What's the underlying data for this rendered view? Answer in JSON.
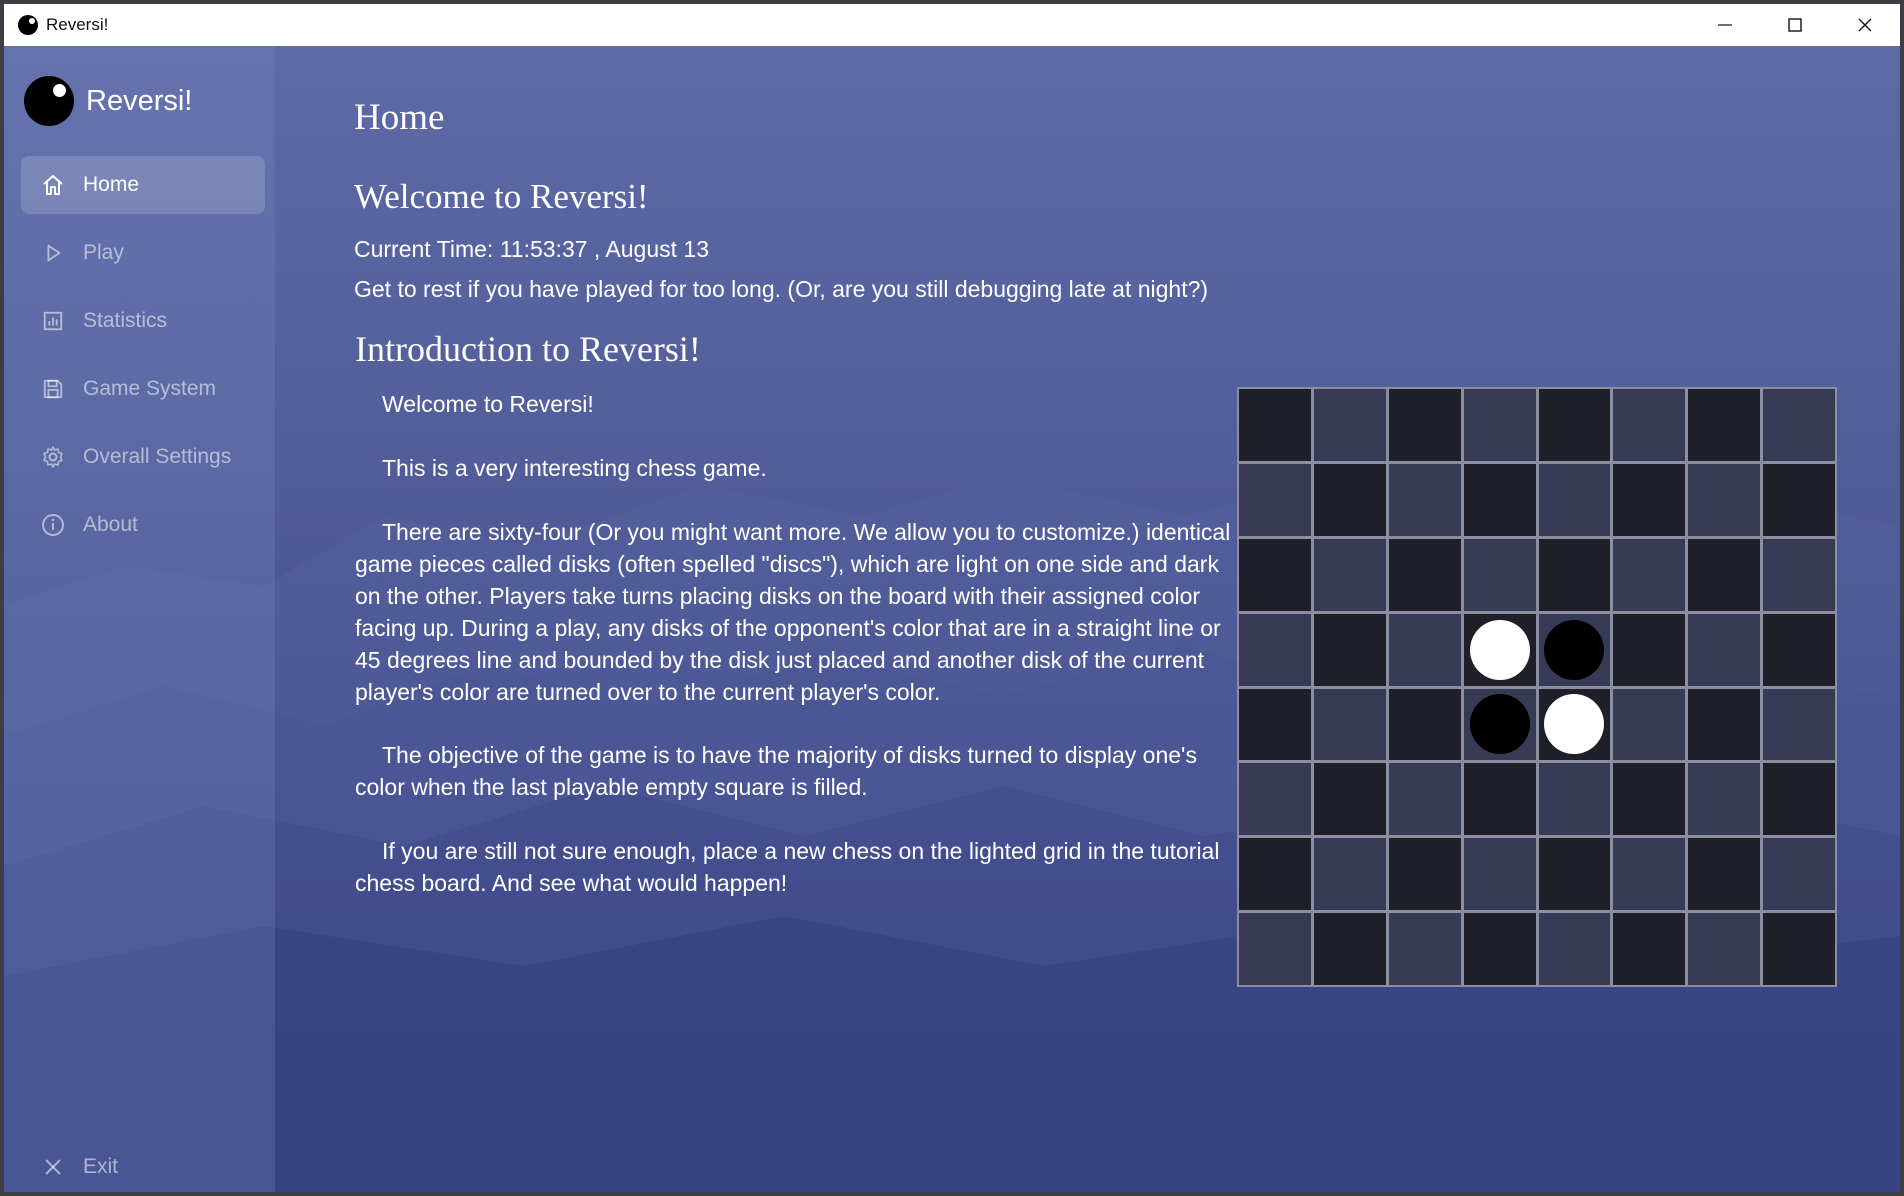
{
  "window": {
    "title": "Reversi!",
    "controls": {
      "minimize": "—",
      "maximize": "☐",
      "close": "✕"
    }
  },
  "sidebar": {
    "brand": "Reversi!",
    "items": [
      {
        "label": "Home",
        "icon": "home-icon",
        "active": true
      },
      {
        "label": "Play",
        "icon": "play-icon",
        "active": false
      },
      {
        "label": "Statistics",
        "icon": "statistics-icon",
        "active": false
      },
      {
        "label": "Game System",
        "icon": "save-icon",
        "active": false
      },
      {
        "label": "Overall Settings",
        "icon": "gear-icon",
        "active": false
      },
      {
        "label": "About",
        "icon": "info-icon",
        "active": false
      }
    ],
    "exit": {
      "label": "Exit",
      "icon": "close-icon"
    }
  },
  "main": {
    "page_title": "Home",
    "welcome_title": "Welcome to Reversi!",
    "current_time": "Current Time: 11:53:37 , August 13",
    "rest_message": "Get to rest if you have played for too long. (Or, are you still debugging late at night?)",
    "intro_title": "Introduction to Reversi!",
    "paragraphs": [
      "Welcome to Reversi!",
      "This is a very interesting chess game.",
      "There are sixty-four (Or you might want more. We allow you to customize.) identical game pieces called disks (often spelled \"discs\"), which are light on one side and dark on the other. Players take turns placing disks on the board with their assigned color facing up. During a play, any disks of the opponent's color that are in a straight line or 45 degrees line and bounded by the disk just placed and another disk of the current player's color are turned over to the current player's color.",
      "The objective of the game is to have the majority of disks turned to display one's color when the last playable empty square is filled.",
      "If you are still not sure enough, place a new chess on the lighted grid in the tutorial chess board. And see what would happen!"
    ]
  },
  "board": {
    "size": 8,
    "discs": [
      {
        "row": 3,
        "col": 3,
        "color": "white"
      },
      {
        "row": 3,
        "col": 4,
        "color": "black"
      },
      {
        "row": 4,
        "col": 3,
        "color": "black"
      },
      {
        "row": 4,
        "col": 4,
        "color": "white"
      }
    ],
    "colors": {
      "dark_cell": "#1e1f28",
      "light_cell": "#363a55",
      "grid": "#8a8ea0"
    }
  }
}
